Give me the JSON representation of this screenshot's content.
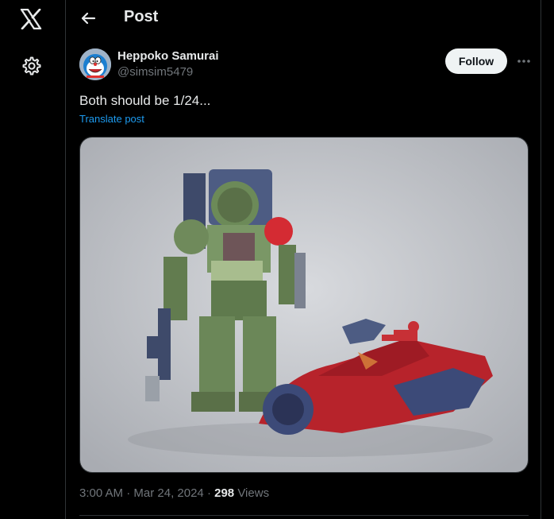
{
  "nav": {
    "logo_icon": "x-logo-icon",
    "settings_icon": "gear-icon"
  },
  "header": {
    "back_icon": "arrow-left-icon",
    "title": "Post"
  },
  "post": {
    "author": {
      "display_name": "Heppoko Samurai",
      "handle": "@simsim5479",
      "avatar_icon": "doraemon-avatar"
    },
    "follow_label": "Follow",
    "more_icon": "ellipsis-icon",
    "text": "Both should be 1/24...",
    "translate_label": "Translate post",
    "media": {
      "description_icon": "photo-robot-and-motorcycle"
    },
    "time": "3:00 AM",
    "date": "Mar 24, 2024",
    "separator": "·",
    "views_count": "298",
    "views_label": "Views"
  },
  "colors": {
    "background": "#000000",
    "text": "#e7e9ea",
    "secondary": "#71767b",
    "link": "#1d9bf0",
    "border": "#2f3336"
  }
}
